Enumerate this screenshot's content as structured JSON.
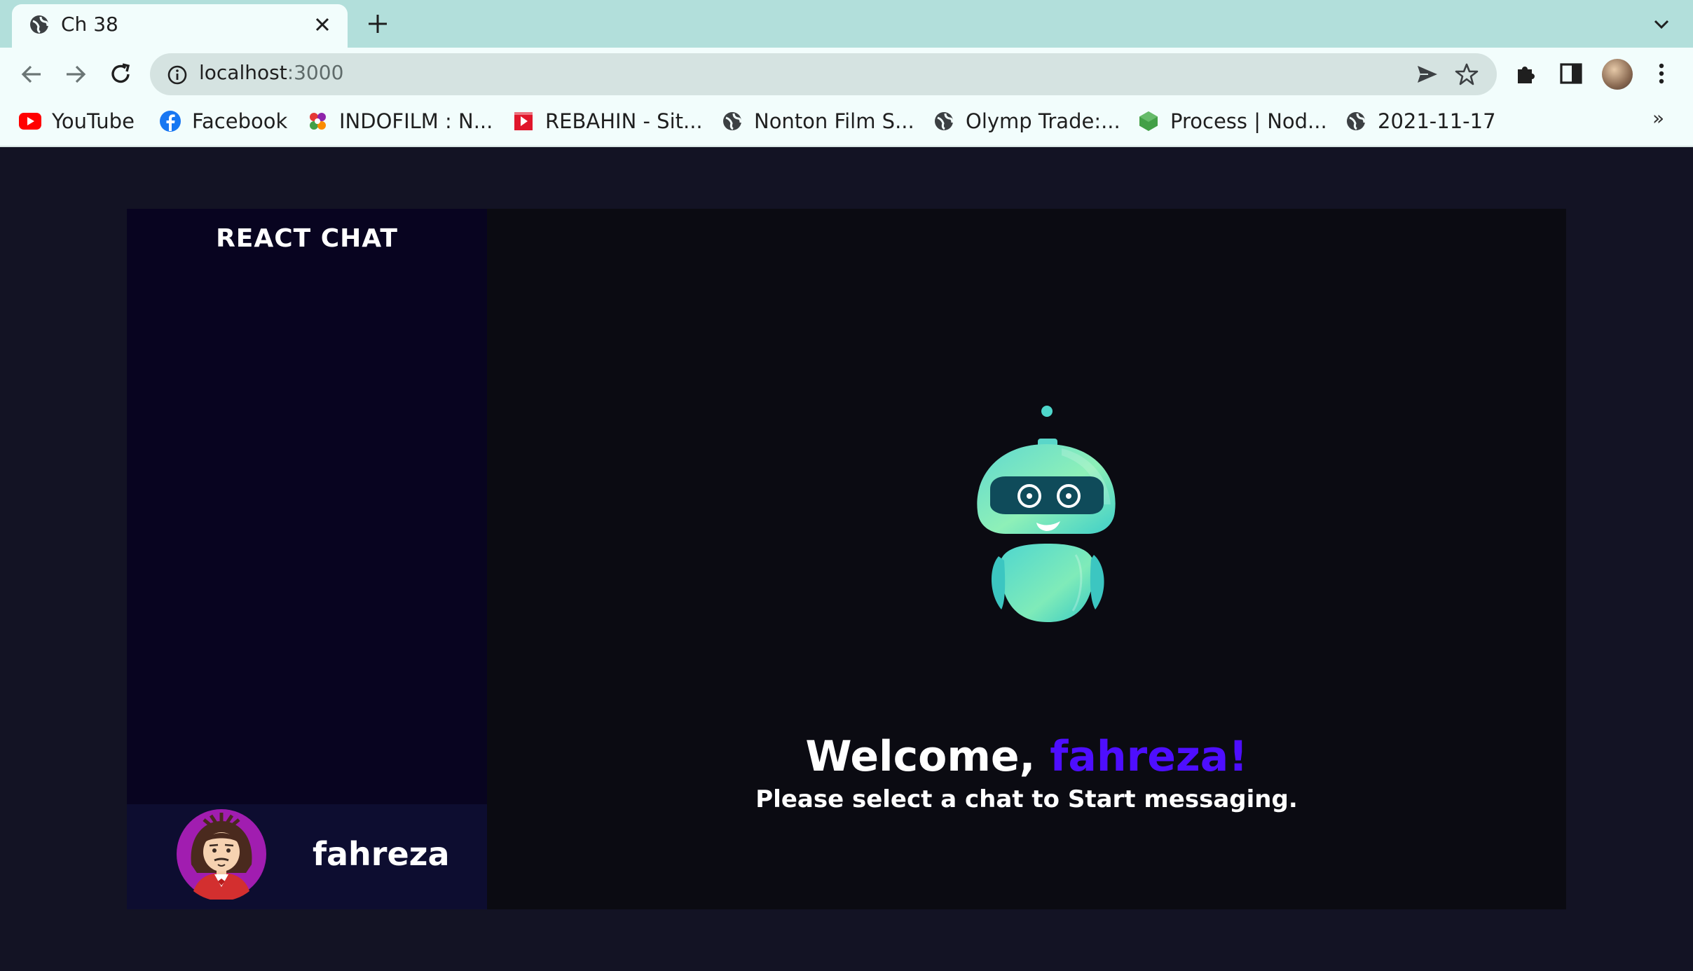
{
  "browser": {
    "tab": {
      "title": "Ch 38"
    },
    "address": {
      "host": "localhost",
      "port": ":3000"
    },
    "bookmarks": [
      {
        "label": "YouTube",
        "icon": "youtube-icon"
      },
      {
        "label": "Facebook",
        "icon": "facebook-icon"
      },
      {
        "label": "INDOFILM : N...",
        "icon": "indofilm-icon"
      },
      {
        "label": "REBAHIN - Sit...",
        "icon": "rebahin-icon"
      },
      {
        "label": "Nonton Film S...",
        "icon": "globe-icon"
      },
      {
        "label": "Olymp Trade:...",
        "icon": "globe-icon"
      },
      {
        "label": "Process | Nod...",
        "icon": "nodejs-icon"
      },
      {
        "label": "2021-11-17",
        "icon": "globe-icon"
      }
    ],
    "more_bookmarks": "»"
  },
  "app": {
    "brand": "REACT CHAT",
    "current_user": {
      "username": "fahreza"
    },
    "welcome": {
      "greeting": "Welcome, ",
      "name": "fahreza!",
      "subtitle": "Please select a chat to Start messaging."
    }
  },
  "colors": {
    "accent": "#4e0eff",
    "page_bg": "#131324",
    "sidebar_bg": "#080420",
    "user_panel_bg": "#0d0d30"
  }
}
